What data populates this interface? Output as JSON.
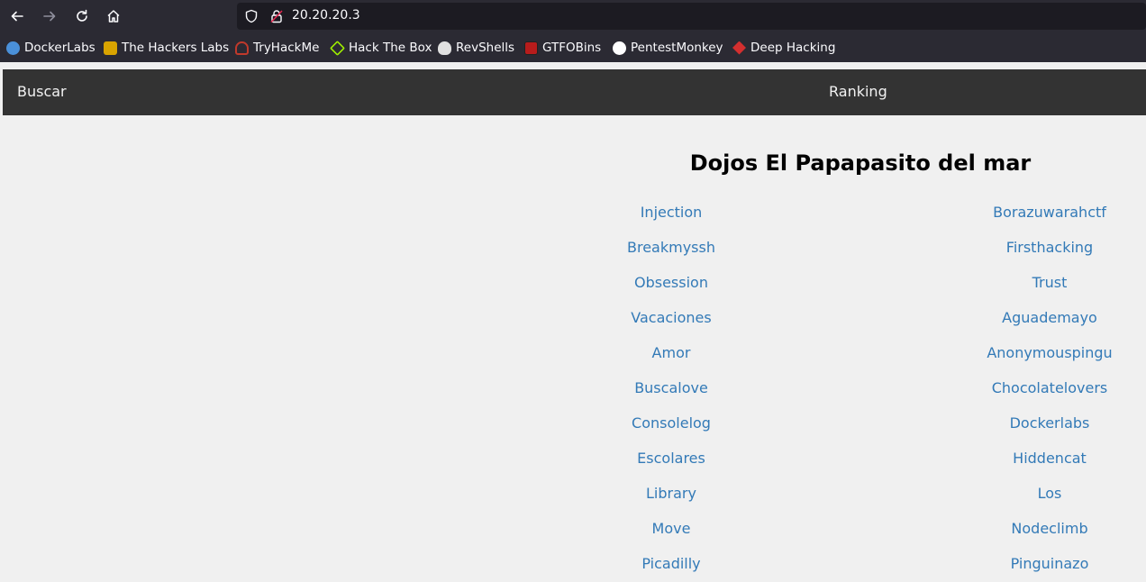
{
  "browser": {
    "url": "20.20.20.3",
    "icons": {
      "back": "arrow-left-icon",
      "forward": "arrow-right-icon",
      "reload": "reload-icon",
      "home": "home-icon",
      "shield": "shield-icon",
      "lock": "lock-icon"
    },
    "bookmarks": [
      {
        "label": "DockerLabs",
        "color": "#4a90d9"
      },
      {
        "label": "The Hackers Labs",
        "color": "#d9a400"
      },
      {
        "label": "TryHackMe",
        "color": "#c0392b"
      },
      {
        "label": "Hack The Box",
        "color": "#9fef00"
      },
      {
        "label": "RevShells",
        "color": "#e0e0e0"
      },
      {
        "label": "GTFOBins",
        "color": "#b71c1c"
      },
      {
        "label": "PentestMonkey",
        "color": "#ffffff"
      },
      {
        "label": "Deep Hacking",
        "color": "#d32f2f"
      }
    ]
  },
  "nav": {
    "search_label": "Buscar",
    "ranking_label": "Ranking"
  },
  "main": {
    "title": "Dojos El Papapasito del mar",
    "left_links": [
      "Injection",
      "Breakmyssh",
      "Obsession",
      "Vacaciones",
      "Amor",
      "Buscalove",
      "Consolelog",
      "Escolares",
      "Library",
      "Move",
      "Picadilly"
    ],
    "right_links": [
      "Borazuwarahctf",
      "Firsthacking",
      "Trust",
      "Aguademayo",
      "Anonymouspingu",
      "Chocolatelovers",
      "Dockerlabs",
      "Hiddencat",
      "Los",
      "Nodeclimb",
      "Pinguinazo"
    ]
  },
  "colors": {
    "link": "#337ab7",
    "navbar": "#333333",
    "page_bg": "#f0f0f0",
    "browser_chrome": "#2b2a33"
  }
}
